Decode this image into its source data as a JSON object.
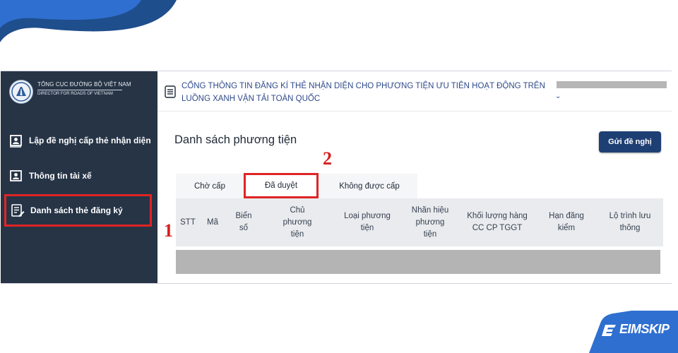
{
  "colors": {
    "sidebar_bg": "#263446",
    "accent": "#1e3f73",
    "highlight": "#e02424",
    "brand_blue": "#2f6fd0"
  },
  "sidebar": {
    "brand_line1": "TỔNG CỤC ĐƯỜNG BỘ VIỆT NAM",
    "brand_line2": "DIRECTOR FOR ROADS OF VIETNAM",
    "items": [
      {
        "label": "Lập đề nghị cấp thẻ nhận diện",
        "icon": "id-card-icon"
      },
      {
        "label": "Thông tin tài xế",
        "icon": "driver-card-icon"
      },
      {
        "label": "Danh sách thẻ đăng ký",
        "icon": "list-edit-icon",
        "active": true
      }
    ]
  },
  "header": {
    "title": "CỔNG THÔNG TIN ĐĂNG KÍ THẺ NHẬN DIỆN CHO PHƯƠNG TIỆN ƯU TIÊN HOẠT ĐỘNG TRÊN LUỒNG XANH VẬN TẢI TOÀN QUỐC",
    "user_chevron": "⌄"
  },
  "main": {
    "page_title": "Danh sách phương tiện",
    "submit_label": "Gửi đề nghị",
    "tabs": [
      {
        "label": "Chờ cấp"
      },
      {
        "label": "Đã duyệt",
        "active": true
      },
      {
        "label": "Không được cấp"
      }
    ],
    "columns": [
      "STT",
      "Mã",
      "Biển số",
      "Chủ phương tiện",
      "Loại phương tiện",
      "Nhãn hiệu phương tiện",
      "Khối lượng hàng CC CP TGGT",
      "Hạn đăng kiểm",
      "Lộ trình lưu thông"
    ]
  },
  "annotations": {
    "step1": "1",
    "step2": "2"
  },
  "footer_brand": "EIMSKIP"
}
